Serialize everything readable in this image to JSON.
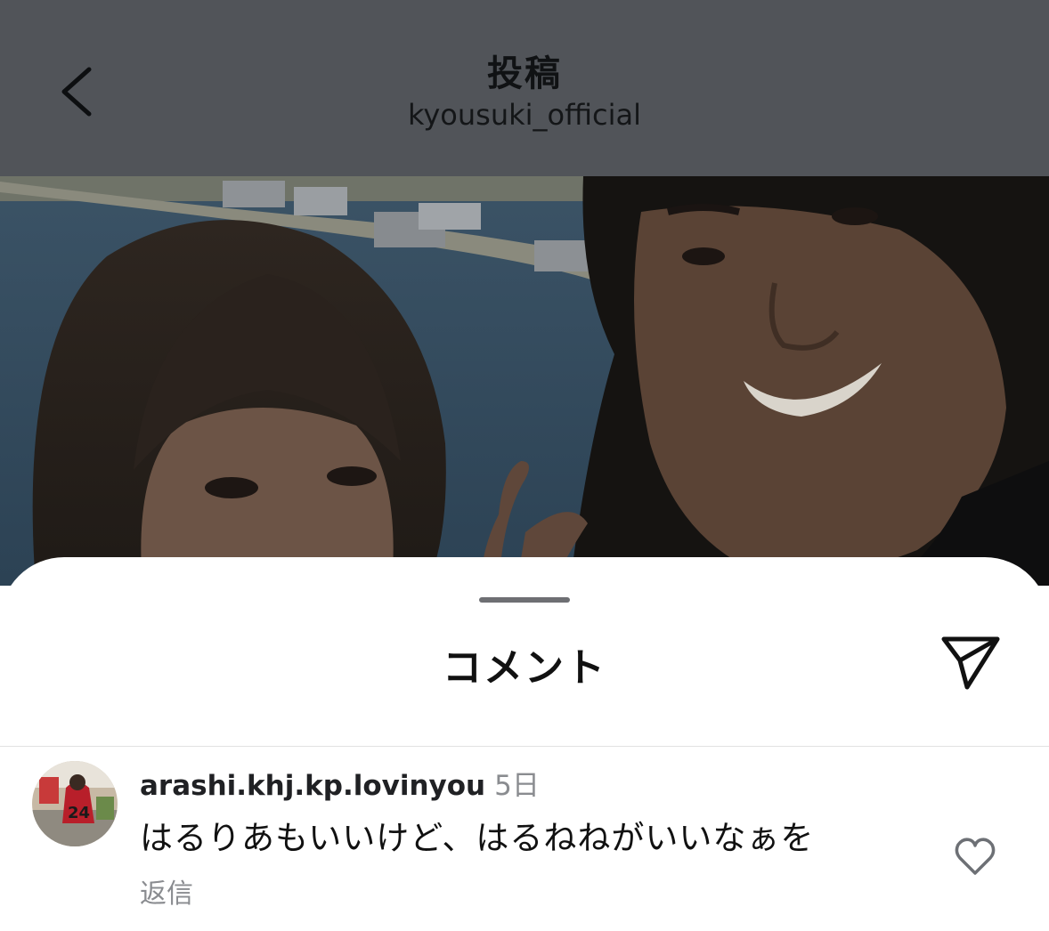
{
  "header": {
    "title": "投稿",
    "subtitle": "kyousuki_official"
  },
  "photo": {
    "description_icon": "post-photo"
  },
  "comments_sheet": {
    "title": "コメント"
  },
  "comments": [
    {
      "username": "arashi.khj.kp.lovinyou",
      "time": "5日",
      "text": "はるりあもいいけど、はるねねがいいなぁを",
      "reply_label": "返信"
    }
  ],
  "colors": {
    "dim_overlay": "#515459",
    "sheet_bg": "#ffffff",
    "secondary_text": "#8a8c90"
  }
}
